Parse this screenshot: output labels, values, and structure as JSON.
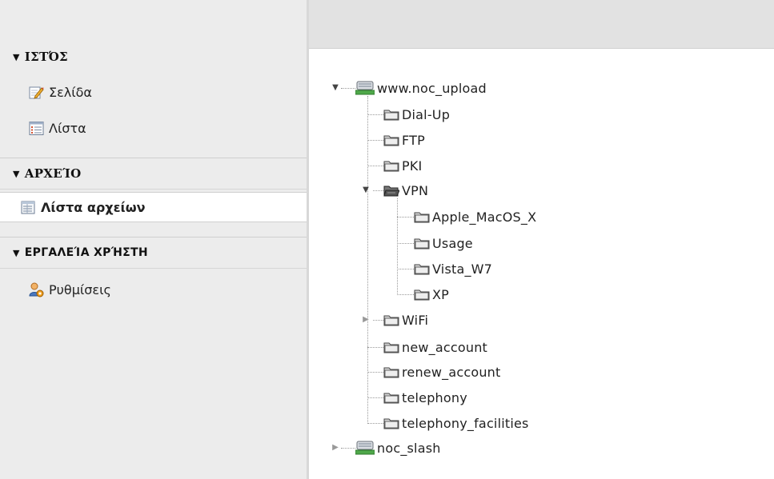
{
  "sidebar": {
    "sections": [
      {
        "title": "ΙΣΤΌΣ",
        "items": [
          {
            "label": "Σελίδα",
            "icon": "edit-page-icon"
          },
          {
            "label": "Λίστα",
            "icon": "list-icon"
          }
        ]
      },
      {
        "title": "ΑΡΧΕΊΟ",
        "items": [
          {
            "label": "Λίστα αρχείων",
            "icon": "file-list-icon",
            "active": true
          }
        ]
      },
      {
        "title": "ΕΡΓΑΛΕΊΑ ΧΡΉΣΤΗ",
        "items": [
          {
            "label": "Ρυθμίσεις",
            "icon": "user-settings-icon"
          }
        ]
      }
    ]
  },
  "tree": {
    "root": "www.noc_upload",
    "children": {
      "dialup": "Dial-Up",
      "ftp": "FTP",
      "pki": "PKI",
      "vpn": "VPN",
      "vpn_children": {
        "apple": "Apple_MacOS_X",
        "usage": "Usage",
        "vista": "Vista_W7",
        "xp": "XP"
      },
      "wifi": "WiFi",
      "new_account": "new_account",
      "renew_account": "renew_account",
      "telephony": "telephony",
      "telephony_facilities": "telephony_facilities"
    },
    "second_root": "noc_slash"
  },
  "colors": {
    "sidebar_bg": "#ececec",
    "topbar_bg": "#e2e2e2",
    "active_bg": "#ffffff",
    "tree_line": "#999999"
  }
}
